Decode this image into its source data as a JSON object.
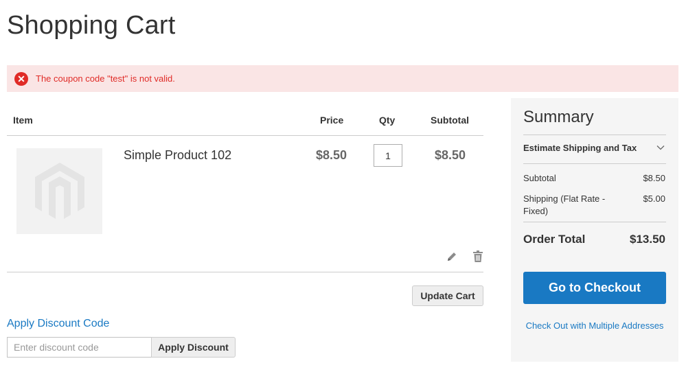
{
  "page": {
    "title": "Shopping Cart"
  },
  "message": {
    "text": "The coupon code \"test\" is not valid.",
    "icon": "error-icon",
    "color": "#e02b27"
  },
  "table": {
    "headers": {
      "item": "Item",
      "price": "Price",
      "qty": "Qty",
      "subtotal": "Subtotal"
    },
    "items": [
      {
        "name": "Simple Product 102",
        "price": "$8.50",
        "qty": "1",
        "subtotal": "$8.50"
      }
    ],
    "update_label": "Update Cart"
  },
  "discount": {
    "title": "Apply Discount Code",
    "placeholder": "Enter discount code",
    "apply_label": "Apply Discount"
  },
  "summary": {
    "title": "Summary",
    "estimate_label": "Estimate Shipping and Tax",
    "subtotal_label": "Subtotal",
    "subtotal_value": "$8.50",
    "shipping_label": "Shipping (Flat Rate - Fixed)",
    "shipping_value": "$5.00",
    "total_label": "Order Total",
    "total_value": "$13.50",
    "checkout_label": "Go to Checkout",
    "multi_label": "Check Out with Multiple Addresses"
  },
  "colors": {
    "accent": "#1979c3",
    "error_bg": "#fae5e5",
    "error_text": "#e02b27"
  }
}
